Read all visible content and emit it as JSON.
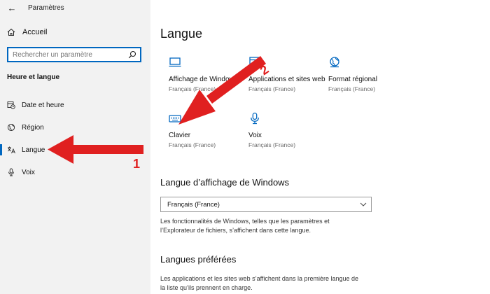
{
  "window": {
    "title": "Paramètres",
    "back_glyph": "←"
  },
  "sidebar": {
    "home_label": "Accueil",
    "search_placeholder": "Rechercher un paramètre",
    "section_title": "Heure et langue",
    "items": [
      {
        "label": "Date et heure",
        "icon": "calendar-clock-icon",
        "active": false
      },
      {
        "label": "Région",
        "icon": "globe-region-icon",
        "active": false
      },
      {
        "label": "Langue",
        "icon": "language-icon",
        "active": true
      },
      {
        "label": "Voix",
        "icon": "microphone-icon",
        "active": false
      }
    ]
  },
  "main": {
    "title": "Langue",
    "tiles": [
      {
        "name": "Affichage de Windows",
        "sub": "Français (France)",
        "icon": "monitor-icon"
      },
      {
        "name": "Applications et sites web",
        "sub": "Français (France)",
        "icon": "app-window-icon"
      },
      {
        "name": "Format régional",
        "sub": "Français (France)",
        "icon": "globe-format-icon"
      },
      {
        "name": "Clavier",
        "sub": "Français (France)",
        "icon": "keyboard-icon"
      },
      {
        "name": "Voix",
        "sub": "Français (France)",
        "icon": "microphone-icon"
      }
    ],
    "display_language": {
      "heading": "Langue d’affichage de Windows",
      "selected": "Français (France)",
      "description": "Les fonctionnalités de Windows, telles que les paramètres et l’Explorateur de fichiers, s’affichent dans cette langue."
    },
    "preferred": {
      "heading": "Langues préférées",
      "description": "Les applications et les sites web s’affichent dans la première langue de la liste qu’ils prennent en charge."
    }
  },
  "annotations": {
    "arrow1_number": "1",
    "arrow2_number": "2",
    "color": "#e02020"
  },
  "colors": {
    "accent": "#0067c0",
    "sidebar_bg": "#f2f2f2"
  }
}
